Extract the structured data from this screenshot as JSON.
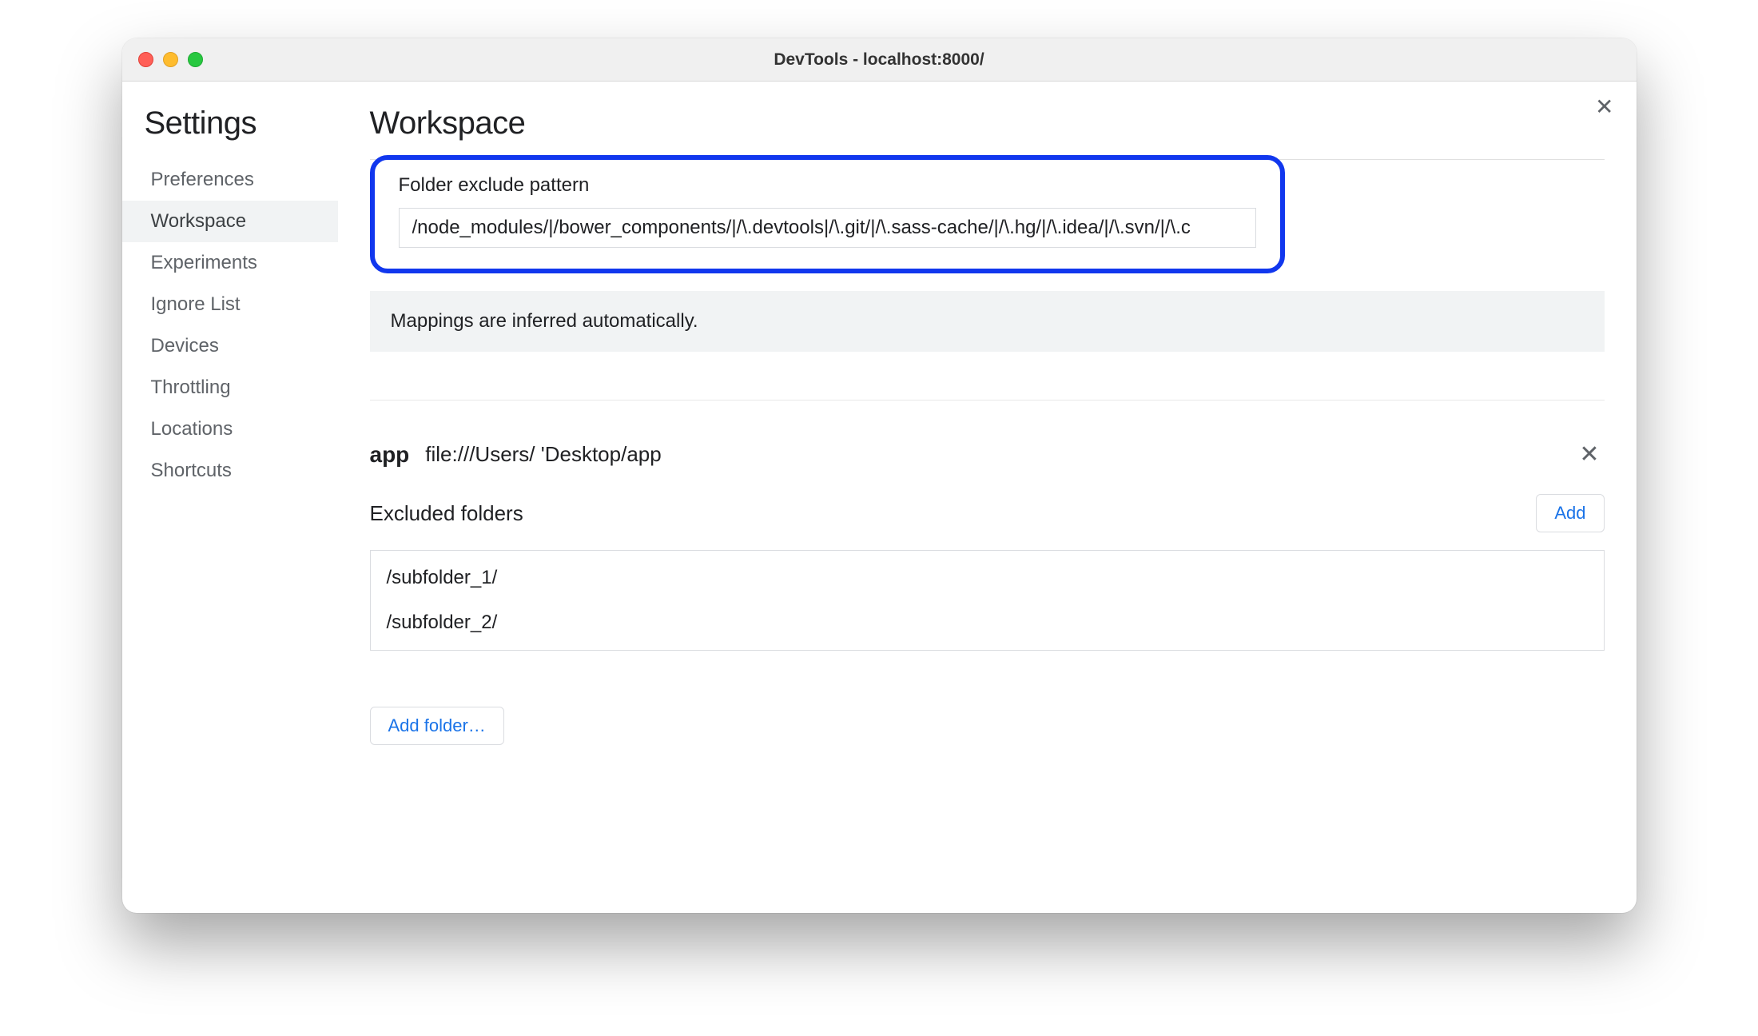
{
  "window": {
    "title": "DevTools - localhost:8000/"
  },
  "sidebar": {
    "title": "Settings",
    "items": [
      {
        "label": "Preferences",
        "active": false
      },
      {
        "label": "Workspace",
        "active": true
      },
      {
        "label": "Experiments",
        "active": false
      },
      {
        "label": "Ignore List",
        "active": false
      },
      {
        "label": "Devices",
        "active": false
      },
      {
        "label": "Throttling",
        "active": false
      },
      {
        "label": "Locations",
        "active": false
      },
      {
        "label": "Shortcuts",
        "active": false
      }
    ]
  },
  "main": {
    "title": "Workspace",
    "exclude_pattern": {
      "label": "Folder exclude pattern",
      "value": "/node_modules/|/bower_components/|/\\.devtools|/\\.git/|/\\.sass-cache/|/\\.hg/|/\\.idea/|/\\.svn/|/\\.c"
    },
    "info_banner": "Mappings are inferred automatically.",
    "folder": {
      "name": "app",
      "path": "file:///Users/        'Desktop/app"
    },
    "excluded": {
      "label": "Excluded folders",
      "add_button": "Add",
      "items": [
        "/subfolder_1/",
        "/subfolder_2/"
      ]
    },
    "add_folder_button": "Add folder…"
  }
}
